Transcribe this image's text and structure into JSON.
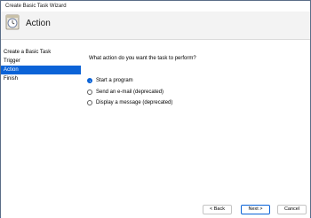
{
  "window": {
    "title": "Create Basic Task Wizard"
  },
  "header": {
    "title": "Action",
    "icon": "task-clock-icon"
  },
  "sidebar": {
    "items": [
      {
        "label": "Create a Basic Task",
        "active": false
      },
      {
        "label": "Trigger",
        "active": false
      },
      {
        "label": "Action",
        "active": true
      },
      {
        "label": "Finish",
        "active": false
      }
    ]
  },
  "main": {
    "question": "What action do you want the task to perform?",
    "options": [
      {
        "label": "Start a program",
        "selected": true
      },
      {
        "label": "Send an e-mail (deprecated)",
        "selected": false
      },
      {
        "label": "Display a message (deprecated)",
        "selected": false
      }
    ]
  },
  "footer": {
    "back_label": "< Back",
    "next_label": "Next >",
    "cancel_label": "Cancel"
  },
  "colors": {
    "accent": "#0b63d7",
    "header_bg": "#f3f3f3"
  }
}
